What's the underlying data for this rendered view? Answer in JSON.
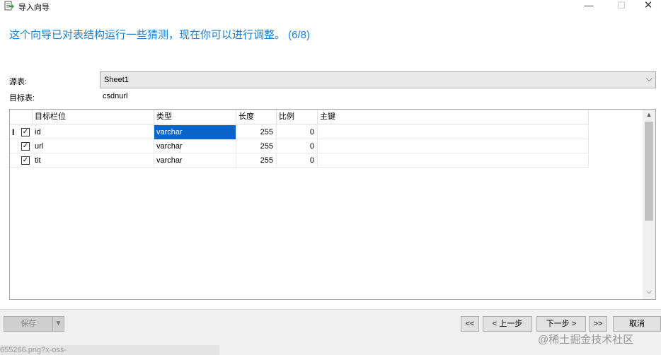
{
  "window": {
    "title": "导入向导",
    "icons": {
      "app": "import-wizard-icon",
      "minimize": "minimize-icon",
      "maximize": "maximize-icon",
      "close": "close-icon"
    },
    "controls": {
      "minimize": "—",
      "maximize": "☐",
      "close": "✕"
    }
  },
  "headline": "这个向导已对表结构运行一些猜测，现在你可以进行调整。 (6/8)",
  "source": {
    "label": "源表:",
    "value": "Sheet1",
    "arrow": "⌵"
  },
  "target": {
    "label": "目标表:",
    "value": "csdnurl"
  },
  "grid": {
    "columns": [
      "目标栏位",
      "类型",
      "长度",
      "比例",
      "主键"
    ],
    "rows": [
      {
        "checked": true,
        "field": "id",
        "type": "varchar",
        "length": "255",
        "scale": "0",
        "key": ""
      },
      {
        "checked": true,
        "field": "url",
        "type": "varchar",
        "length": "255",
        "scale": "0",
        "key": ""
      },
      {
        "checked": true,
        "field": "tit",
        "type": "varchar",
        "length": "255",
        "scale": "0",
        "key": ""
      }
    ],
    "cursor_marker": "I",
    "check_glyph": "✓",
    "scroll_up": "▲",
    "scroll_down": "⌵"
  },
  "buttons": {
    "save": "保存",
    "save_dropdown": "▼",
    "first": "<<",
    "prev": "< 上一步",
    "next": "下一步 >",
    "last": ">>",
    "cancel": "取消"
  },
  "background_text": "655266.png?x-oss-",
  "watermark": "@稀土掘金技术社区",
  "colors": {
    "headline": "#1c7fd0",
    "selection": "#0a64c8"
  }
}
